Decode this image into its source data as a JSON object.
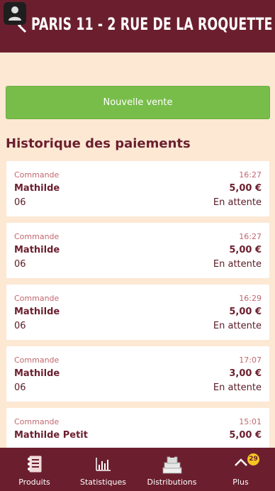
{
  "header": {
    "title": "PARIS 11 - 2 RUE DE LA ROQUETTE"
  },
  "actions": {
    "new_sale": "Nouvelle vente"
  },
  "history": {
    "title": "Historique des paiements",
    "items": [
      {
        "label": "Commande",
        "time": "16:27",
        "name": "Mathilde",
        "amount": "5,00 €",
        "ref": "06",
        "status": "En attente"
      },
      {
        "label": "Commande",
        "time": "16:27",
        "name": "Mathilde",
        "amount": "5,00 €",
        "ref": "06",
        "status": "En attente"
      },
      {
        "label": "Commande",
        "time": "16:29",
        "name": "Mathilde",
        "amount": "5,00 €",
        "ref": "06",
        "status": "En attente"
      },
      {
        "label": "Commande",
        "time": "17:07",
        "name": "Mathilde",
        "amount": "3,00 €",
        "ref": "06",
        "status": "En attente"
      },
      {
        "label": "Commande",
        "time": "15:01",
        "name": "Mathilde Petit",
        "amount": "5,00 €",
        "ref": "",
        "status": ""
      }
    ]
  },
  "nav": {
    "produits": "Produits",
    "statistiques": "Statistiques",
    "distributions": "Distributions",
    "plus": "Plus",
    "plus_badge": "29"
  },
  "colors": {
    "primary": "#6b1f2e",
    "background": "#fde8d4",
    "accent": "#78bd4a",
    "badge": "#f5c623"
  },
  "icons": [
    "user-icon",
    "back-arrow-icon",
    "products-notebook-icon",
    "stats-chart-icon",
    "distributions-stack-icon",
    "chevron-up-icon"
  ]
}
